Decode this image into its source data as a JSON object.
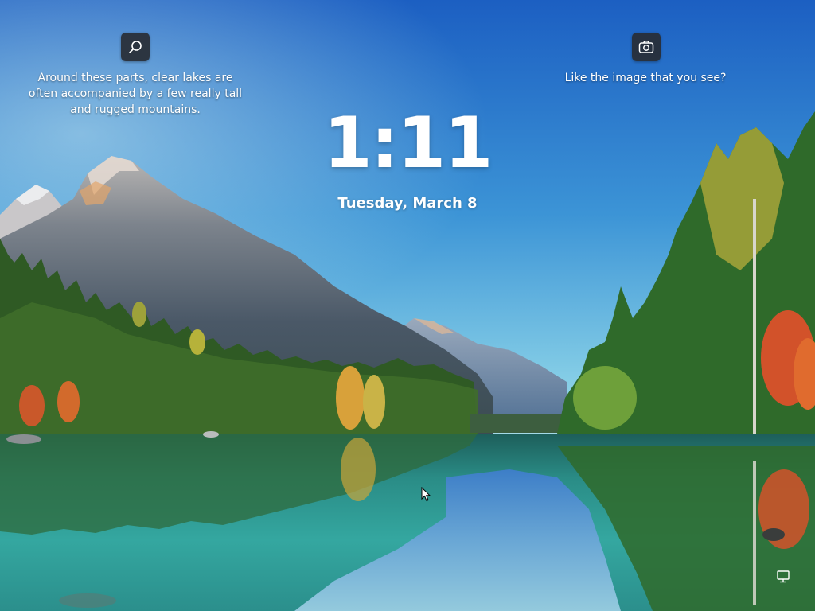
{
  "lockscreen": {
    "time": "1:11",
    "date": "Tuesday, March 8"
  },
  "spotlight": {
    "info_caption_lines": [
      "Around these parts, clear lakes are",
      "often accompanied by a few really tall",
      "and rugged mountains."
    ],
    "like_caption": "Like the image that you see?",
    "info_icon": "search-icon",
    "like_icon": "camera-icon"
  },
  "system": {
    "network_icon": "network-icon"
  },
  "colors": {
    "sky_top": "#1f63c6",
    "sky_bottom": "#8fd3ea",
    "mountain": "#4c5a6a",
    "forest": "#3d6b2c",
    "lake": "#2f9c98",
    "text": "#ffffff"
  }
}
